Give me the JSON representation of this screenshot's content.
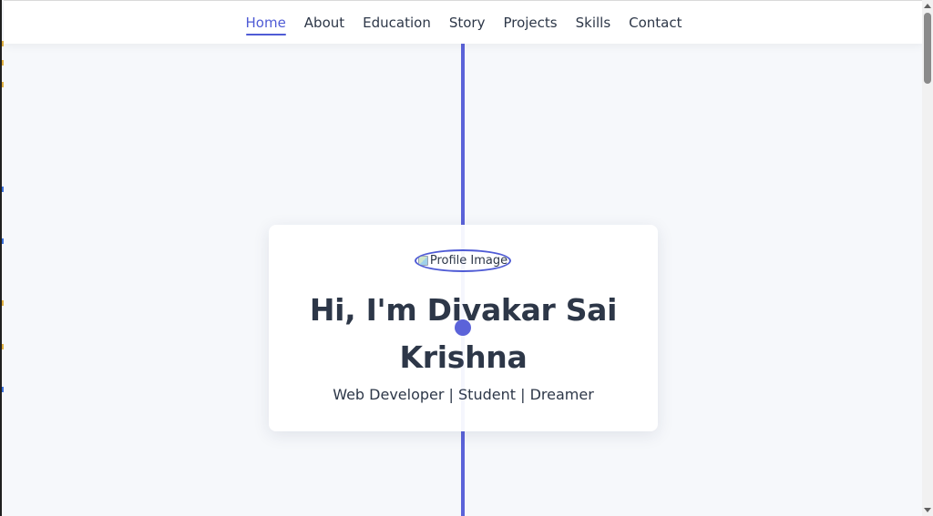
{
  "nav": {
    "items": [
      {
        "label": "Home",
        "active": true
      },
      {
        "label": "About",
        "active": false
      },
      {
        "label": "Education",
        "active": false
      },
      {
        "label": "Story",
        "active": false
      },
      {
        "label": "Projects",
        "active": false
      },
      {
        "label": "Skills",
        "active": false
      },
      {
        "label": "Contact",
        "active": false
      }
    ]
  },
  "hero": {
    "profile_alt": "Profile Image",
    "title": "Hi, I'm Divakar Sai Krishna",
    "subtitle": "Web Developer | Student | Dreamer"
  },
  "colors": {
    "accent": "#4f5bd5",
    "timeline": "#5b63d9",
    "text": "#2d3748",
    "background": "#f6f8fb"
  },
  "icons": {
    "broken_image": "broken-image-icon"
  }
}
